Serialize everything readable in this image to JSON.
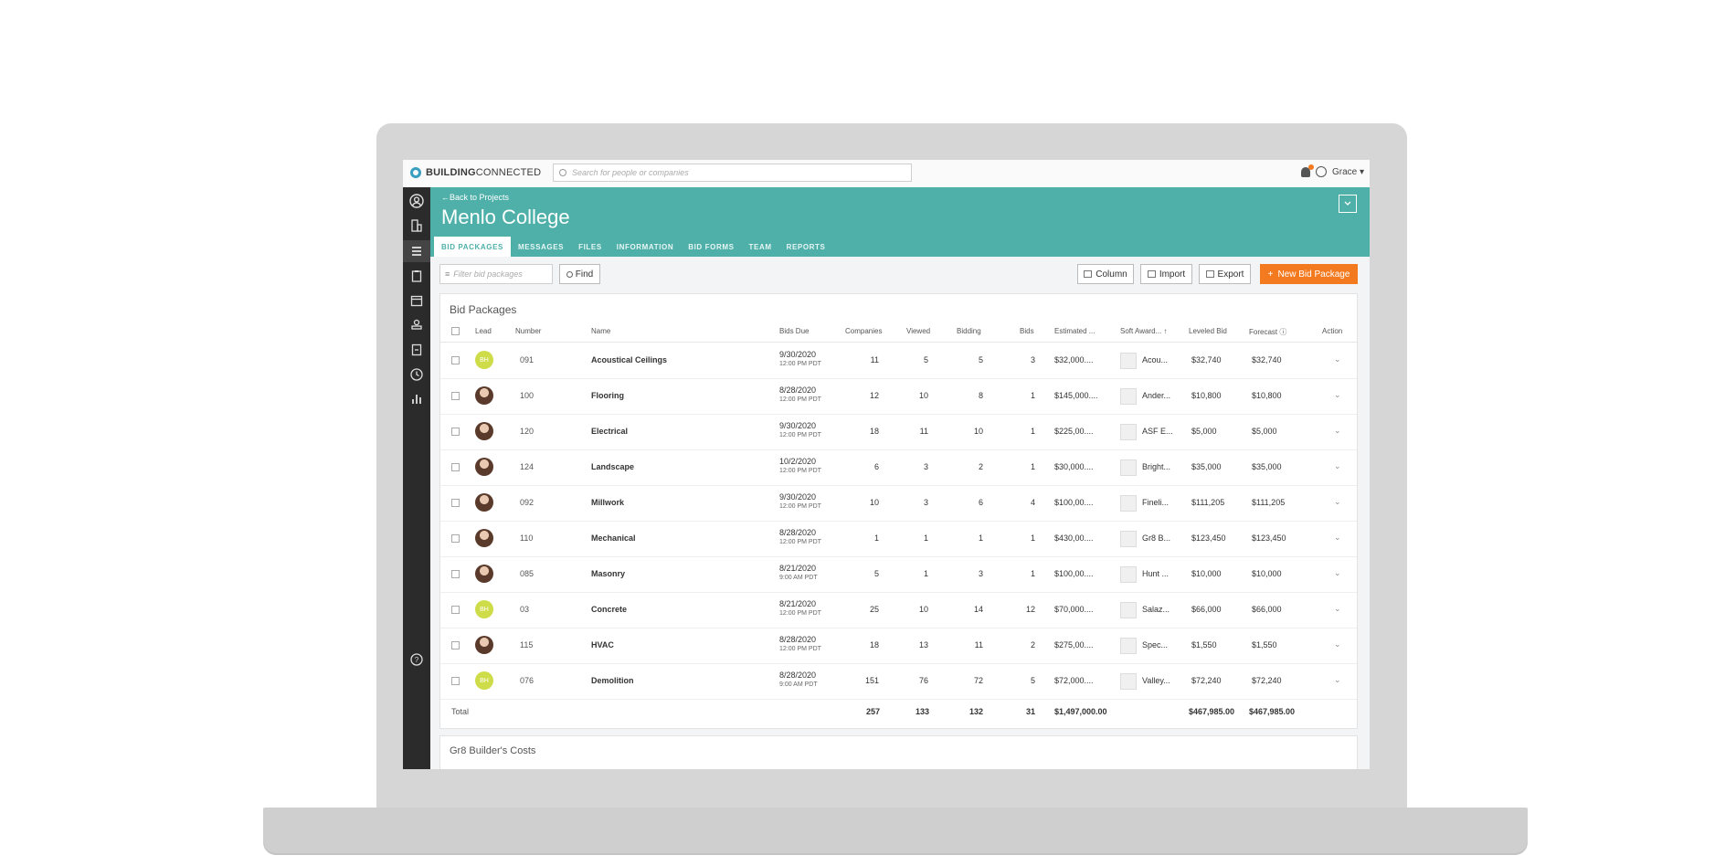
{
  "app": {
    "brand_bold": "BUILDING",
    "brand_thin": "CONNECTED"
  },
  "search": {
    "placeholder": "Search for people or companies"
  },
  "user": {
    "name": "Grace ▾"
  },
  "header": {
    "back_link": "←Back to Projects",
    "title": "Menlo College"
  },
  "tabs": [
    {
      "label": "BID PACKAGES",
      "active": true
    },
    {
      "label": "MESSAGES"
    },
    {
      "label": "FILES"
    },
    {
      "label": "INFORMATION"
    },
    {
      "label": "BID FORMS"
    },
    {
      "label": "TEAM"
    },
    {
      "label": "REPORTS"
    }
  ],
  "toolbar": {
    "filter_placeholder": "Filter bid packages",
    "find": "Find",
    "column": "Column",
    "import": "Import",
    "export": "Export",
    "new_bid_package": "New Bid Package"
  },
  "table": {
    "title": "Bid Packages",
    "columns": {
      "lead": "Lead",
      "number": "Number",
      "name": "Name",
      "bids_due": "Bids Due",
      "companies": "Companies",
      "viewed": "Viewed",
      "bidding": "Bidding",
      "bids": "Bids",
      "estimated": "Estimated ...",
      "soft_award": "Soft Award... ↑",
      "leveled_bid": "Leveled Bid",
      "forecast": "Forecast ⓘ",
      "action": "Action"
    },
    "rows": [
      {
        "lead": "BH",
        "number": "091",
        "name": "Acoustical Ceilings",
        "date": "9/30/2020",
        "time": "12:00 PM PDT",
        "companies": "11",
        "viewed": "5",
        "bidding": "5",
        "bids": "3",
        "estimated": "$32,000....",
        "soft_award": "Acou...",
        "leveled": "$32,740",
        "forecast": "$32,740"
      },
      {
        "lead": "",
        "number": "100",
        "name": "Flooring",
        "date": "8/28/2020",
        "time": "12:00 PM PDT",
        "companies": "12",
        "viewed": "10",
        "bidding": "8",
        "bids": "1",
        "estimated": "$145,000....",
        "soft_award": "Ander...",
        "leveled": "$10,800",
        "forecast": "$10,800"
      },
      {
        "lead": "",
        "number": "120",
        "name": "Electrical",
        "date": "9/30/2020",
        "time": "12:00 PM PDT",
        "companies": "18",
        "viewed": "11",
        "bidding": "10",
        "bids": "1",
        "estimated": "$225,00....",
        "soft_award": "ASF E...",
        "leveled": "$5,000",
        "forecast": "$5,000"
      },
      {
        "lead": "",
        "number": "124",
        "name": "Landscape",
        "date": "10/2/2020",
        "time": "12:00 PM PDT",
        "companies": "6",
        "viewed": "3",
        "bidding": "2",
        "bids": "1",
        "estimated": "$30,000....",
        "soft_award": "Bright...",
        "leveled": "$35,000",
        "forecast": "$35,000"
      },
      {
        "lead": "",
        "number": "092",
        "name": "Millwork",
        "date": "9/30/2020",
        "time": "12:00 PM PDT",
        "companies": "10",
        "viewed": "3",
        "bidding": "6",
        "bids": "4",
        "estimated": "$100,00....",
        "soft_award": "Fineli...",
        "leveled": "$111,205",
        "forecast": "$111,205"
      },
      {
        "lead": "",
        "number": "110",
        "name": "Mechanical",
        "date": "8/28/2020",
        "time": "12:00 PM PDT",
        "companies": "1",
        "viewed": "1",
        "bidding": "1",
        "bids": "1",
        "estimated": "$430,00....",
        "soft_award": "Gr8 B...",
        "leveled": "$123,450",
        "forecast": "$123,450"
      },
      {
        "lead": "",
        "number": "085",
        "name": "Masonry",
        "date": "8/21/2020",
        "time": "9:00 AM PDT",
        "companies": "5",
        "viewed": "1",
        "bidding": "3",
        "bids": "1",
        "estimated": "$100,00....",
        "soft_award": "Hunt ...",
        "leveled": "$10,000",
        "forecast": "$10,000"
      },
      {
        "lead": "BH",
        "number": "03",
        "name": "Concrete",
        "date": "8/21/2020",
        "time": "12:00 PM PDT",
        "companies": "25",
        "viewed": "10",
        "bidding": "14",
        "bids": "12",
        "estimated": "$70,000....",
        "soft_award": "Salaz...",
        "leveled": "$66,000",
        "forecast": "$66,000"
      },
      {
        "lead": "",
        "number": "115",
        "name": "HVAC",
        "date": "8/28/2020",
        "time": "12:00 PM PDT",
        "companies": "18",
        "viewed": "13",
        "bidding": "11",
        "bids": "2",
        "estimated": "$275,00....",
        "soft_award": "Spec...",
        "leveled": "$1,550",
        "forecast": "$1,550"
      },
      {
        "lead": "BH",
        "number": "076",
        "name": "Demolition",
        "date": "8/28/2020",
        "time": "9:00 AM PDT",
        "companies": "151",
        "viewed": "76",
        "bidding": "72",
        "bids": "5",
        "estimated": "$72,000....",
        "soft_award": "Valley...",
        "leveled": "$72,240",
        "forecast": "$72,240"
      }
    ],
    "total": {
      "label": "Total",
      "companies": "257",
      "viewed": "133",
      "bidding": "132",
      "bids": "31",
      "estimated": "$1,497,000.00",
      "leveled": "$467,985.00",
      "forecast": "$467,985.00"
    }
  },
  "next_section": {
    "title": "Gr8 Builder's Costs"
  },
  "colors": {
    "header": "#4fb0a9",
    "accent": "#f47a20",
    "sidebar": "#2b2b2b"
  },
  "sidebar_icons": [
    "user-circle-icon",
    "building-icon",
    "list-icon",
    "clipboard-icon",
    "calendar-icon",
    "stamp-icon",
    "document-icon",
    "clock-icon",
    "bar-chart-icon",
    "help-icon"
  ]
}
